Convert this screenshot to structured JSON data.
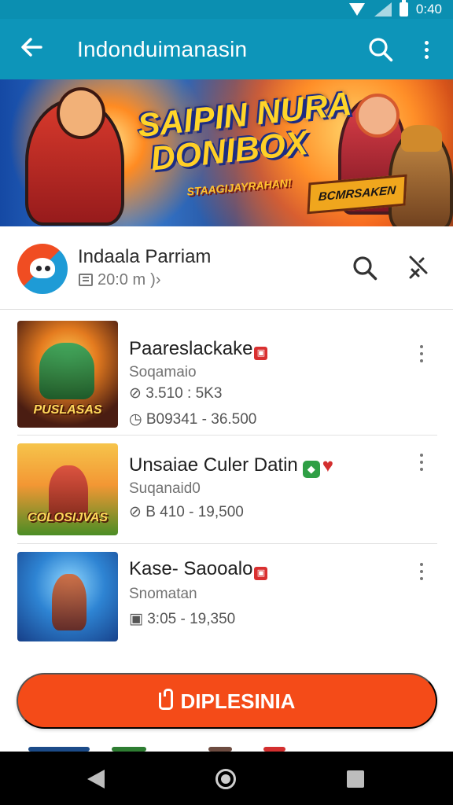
{
  "status_bar": {
    "time": "0:40"
  },
  "app_bar": {
    "title": "Indonduimanasin",
    "back_icon": "arrow-left-icon",
    "search_icon": "search-icon",
    "more_icon": "more-vertical-icon"
  },
  "banner": {
    "title_line_1": "SAIPIN NURA",
    "title_line_2": "DONIBOX",
    "subtitle": "STAAGIJAYRAHAN!",
    "badge": "BCMRSAKEN"
  },
  "profile": {
    "name": "Indaala Parriam",
    "meta": "20:0 m",
    "meta_suffix": ")›",
    "search_icon": "search-icon",
    "tool_icon": "tool-icon"
  },
  "games": [
    {
      "title": "Paareslackake",
      "publisher": "Soqamaio",
      "stat_1": "3.510 : 5K3",
      "stat_2": "B09341 - 36.500",
      "thumb_label": "PUSLASAS"
    },
    {
      "title": "Unsaiae Culer Datin",
      "publisher": "Suqanaid0",
      "stat_1": "B 410 - 19,500",
      "thumb_label": "COLOSIJVAS"
    },
    {
      "title": "Kase- Saooalo",
      "publisher": "Snomatan",
      "stat_1": "3:05 - 19,350",
      "thumb_label": ""
    }
  ],
  "cta": {
    "label": "DIPLESINIA"
  },
  "colors": {
    "status_bar": "#0b8fb1",
    "app_bar": "#0d95b9",
    "cta": "#f44b18",
    "navbar": "#000000"
  }
}
